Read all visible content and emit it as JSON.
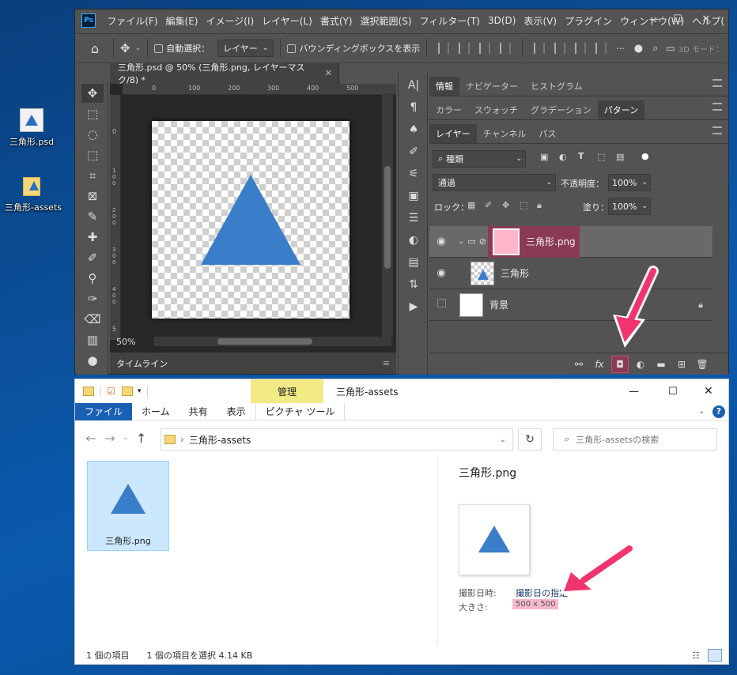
{
  "desktop": {
    "icons": [
      {
        "label": "三角形.psd",
        "icon": "psd-file-icon"
      },
      {
        "label": "三角形-assets",
        "icon": "folder-icon"
      }
    ]
  },
  "photoshop": {
    "logo": "Ps",
    "menu": [
      "ファイル(F)",
      "編集(E)",
      "イメージ(I)",
      "レイヤー(L)",
      "書式(Y)",
      "選択範囲(S)",
      "フィルター(T)",
      "3D(D)",
      "表示(V)",
      "プラグイン",
      "ウィンドウ(W)",
      "ヘルプ("
    ],
    "options": {
      "auto_select_label": "自動選択：",
      "auto_select_value": "レイヤー",
      "bounding_box_label": "バウンディングボックスを表示",
      "mode_3d": "3D モード："
    },
    "doc_tab": "三角形.psd @ 50% (三角形.png, レイヤーマスク/8) *",
    "ruler_h": [
      "0",
      "100",
      "200",
      "300",
      "400",
      "500"
    ],
    "ruler_v": [
      "0",
      "1 0 0",
      "2 0 0",
      "3 0 0",
      "4 0 0",
      "5"
    ],
    "zoom": "50%",
    "timeline": "タイムライン",
    "panel_tabs_1": [
      "情報",
      "ナビゲーター",
      "ヒストグラム"
    ],
    "panel_tabs_2": [
      "カラー",
      "スウォッチ",
      "グラデーション",
      "パターン"
    ],
    "panel_tabs_3": [
      "レイヤー",
      "チャンネル",
      "パス"
    ],
    "layers": {
      "filter_kind": "種類",
      "blend_mode": "通過",
      "opacity_label": "不透明度：",
      "opacity_value": "100%",
      "lock_label": "ロック：",
      "fill_label": "塗り：",
      "fill_value": "100%",
      "rows": [
        {
          "name": "三角形.png"
        },
        {
          "name": "三角形"
        },
        {
          "name": "背景"
        }
      ]
    },
    "colors": {
      "highlight": "#8a3a55",
      "mask_thumb": "#ffb6c8",
      "triangle": "#3a7dc9",
      "arrow": "#f0346e"
    }
  },
  "explorer": {
    "title": "三角形-assets",
    "manage_tab": "管理",
    "ribbon_tabs": [
      "ファイル",
      "ホーム",
      "共有",
      "表示",
      "ピクチャ ツール"
    ],
    "breadcrumb": "三角形-assets",
    "search_placeholder": "三角形-assetsの検索",
    "file_name": "三角形.png",
    "preview": {
      "title": "三角形.png",
      "date_label": "撮影日時:",
      "date_value": "撮影日の指定",
      "size_label": "大きさ:",
      "size_value": "500 x 500"
    },
    "status": {
      "count": "1 個の項目",
      "selected": "1 個の項目を選択  4.14 KB"
    }
  }
}
